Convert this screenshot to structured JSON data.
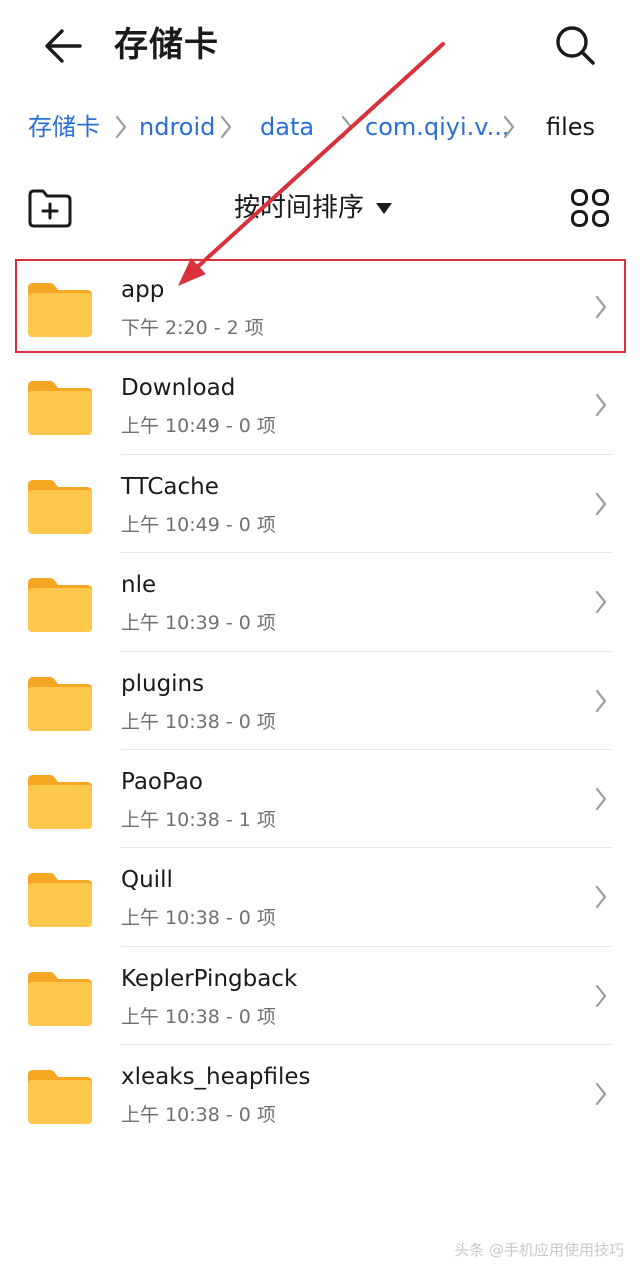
{
  "header": {
    "title": "存储卡",
    "back_icon": "arrow-left-icon",
    "search_icon": "search-icon"
  },
  "breadcrumb": [
    {
      "label": "存储卡",
      "current": false
    },
    {
      "label": "ndroid",
      "current": false
    },
    {
      "label": "data",
      "current": false
    },
    {
      "label": "com.qiyi.v...",
      "current": false
    },
    {
      "label": "files",
      "current": true
    }
  ],
  "toolbar": {
    "new_folder_icon": "folder-add-icon",
    "sort_label": "按时间排序",
    "sort_caret_icon": "caret-down-icon",
    "view_toggle_icon": "grid-view-icon"
  },
  "files": [
    {
      "name": "app",
      "meta": "下午 2:20  - 2 项",
      "highlighted": true
    },
    {
      "name": "Download",
      "meta": "上午 10:49  - 0 项"
    },
    {
      "name": "TTCache",
      "meta": "上午 10:49  - 0 项"
    },
    {
      "name": "nle",
      "meta": "上午 10:39  - 0 项"
    },
    {
      "name": "plugins",
      "meta": "上午 10:38  - 0 项"
    },
    {
      "name": "PaoPao",
      "meta": "上午 10:38  - 1 项"
    },
    {
      "name": "Quill",
      "meta": "上午 10:38  - 0 项"
    },
    {
      "name": "KeplerPingback",
      "meta": "上午 10:38  - 0 项"
    },
    {
      "name": "xleaks_heapfiles",
      "meta": "上午 10:38  - 0 项"
    }
  ],
  "watermark": "头条 @手机应用使用技巧",
  "colors": {
    "accent": "#2a6fd6",
    "folder": "#ffc84d",
    "folder_tab": "#f6a623",
    "annotation": "#d9303a"
  }
}
